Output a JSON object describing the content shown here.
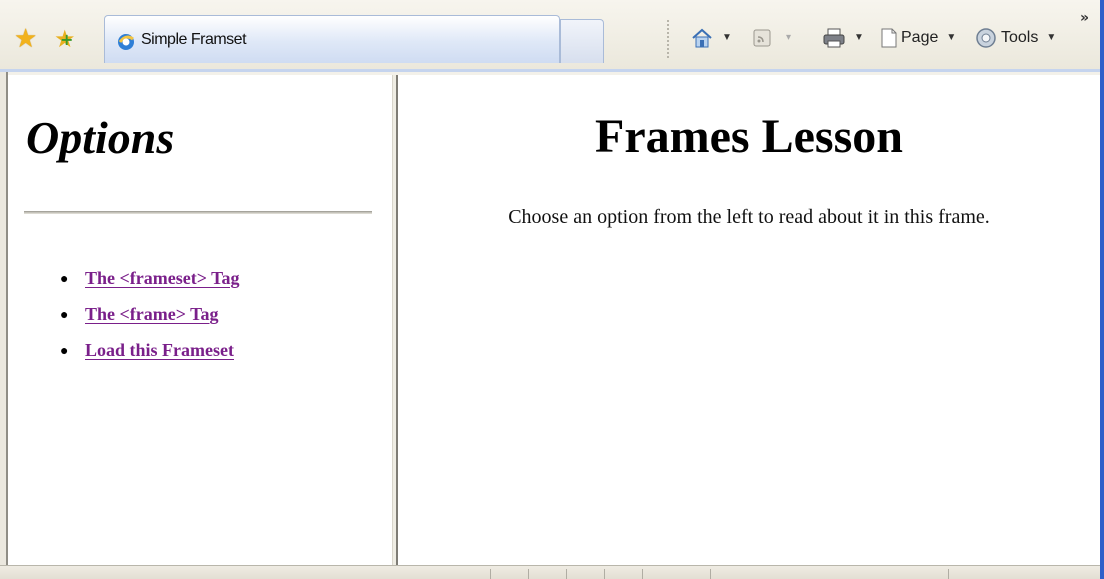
{
  "browser": {
    "tab_title": "Simple Framset",
    "toolbar": {
      "page_label": "Page",
      "tools_label": "Tools",
      "chevron": "»"
    },
    "icons": [
      "favorites-star-icon",
      "add-favorites-icon",
      "ie-page-icon",
      "home-icon",
      "feeds-icon",
      "print-icon",
      "page-icon",
      "tools-gear-icon"
    ]
  },
  "left_frame": {
    "title": "Options",
    "links": [
      {
        "label": "The <frameset> Tag"
      },
      {
        "label": "The <frame> Tag"
      },
      {
        "label": "Load this Frameset"
      }
    ],
    "link_color": "#7a1f8a"
  },
  "right_frame": {
    "title": "Frames Lesson",
    "text": "Choose an option from the left to read about it in this frame."
  }
}
